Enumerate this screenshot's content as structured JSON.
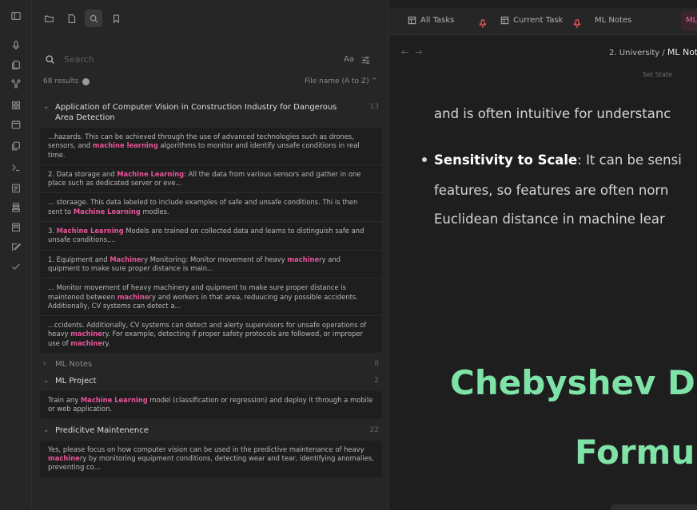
{
  "ribbon": {
    "icons": [
      "sidebar-toggle-icon",
      "microphone-icon",
      "file-copy-icon",
      "graph-icon",
      "grid-icon",
      "calendar-icon",
      "copy-icon",
      "terminal-icon",
      "template-icon",
      "layers-icon",
      "book-icon",
      "edit-icon",
      "check-icon"
    ]
  },
  "panel": {
    "tabs": [
      "folder-icon",
      "file-icon",
      "search-icon",
      "bookmark-icon"
    ],
    "search": {
      "placeholder": "Search",
      "value": "",
      "match_case_label": "Aa"
    },
    "results_count": "68 results",
    "sort_label": "File name (A to Z) ⌃",
    "files": [
      {
        "title": "Application of Computer Vision in Construction Industry for Dangerous Area Detection",
        "count": "13",
        "expanded": true,
        "matches": [
          [
            {
              "t": "...hazards. This can be achieved through the use of advanced technologies such as drones, sensors, and "
            },
            {
              "t": "machine learning",
              "h": true
            },
            {
              "t": " algorithms to monitor and identify unsafe conditions in real time."
            }
          ],
          [
            {
              "t": "2. Data storage and "
            },
            {
              "t": "Machine Learning",
              "h": true
            },
            {
              "t": ": All the data from various sensors and gather in one place such as dedicated server or eve..."
            }
          ],
          [
            {
              "t": "... storaage. This data labeled to include examples of safe and unsafe conditions. Thi is then sent to "
            },
            {
              "t": "Machine Learning",
              "h": true
            },
            {
              "t": " modles."
            }
          ],
          [
            {
              "t": "3. "
            },
            {
              "t": "Machine Learning",
              "h": true
            },
            {
              "t": " Models are trained on collected data and learns to distinguish safe and unsafe conditions,..."
            }
          ],
          [
            {
              "t": "1. Equipment and "
            },
            {
              "t": "Machine",
              "h": true
            },
            {
              "t": "ry Monitoring: Monitor movement of heavy "
            },
            {
              "t": "machine",
              "h": true
            },
            {
              "t": "ry and quipment to make sure proper distance is main..."
            }
          ],
          [
            {
              "t": "... Monitor movement of heavy machinery and quipment to make sure proper distance is maintened between "
            },
            {
              "t": "machine",
              "h": true
            },
            {
              "t": "ry and workers in that area, reduucing any possible accidents. Additionally, CV systems can detect a..."
            }
          ],
          [
            {
              "t": "...ccidents. Additionally, CV systems can detect and alerty supervisors for unsafe operations of heavy "
            },
            {
              "t": "machine",
              "h": true
            },
            {
              "t": "ry. For example, detecting if proper safety protocols are followed, or improper use of "
            },
            {
              "t": "machine",
              "h": true
            },
            {
              "t": "ry."
            }
          ]
        ]
      },
      {
        "title": "ML Notes",
        "count": "8",
        "expanded": false,
        "matches": []
      },
      {
        "title": "ML Project",
        "count": "2",
        "expanded": true,
        "matches": [
          [
            {
              "t": "Train any "
            },
            {
              "t": "Machine Learning",
              "h": true
            },
            {
              "t": " model (classification or regression) and deploy it through a mobile or web application."
            }
          ]
        ]
      },
      {
        "title": "Predicitve Maintenence",
        "count": "22",
        "expanded": true,
        "matches": [
          [
            {
              "t": "Yes, please focus on how computer vision can be used in the predictive maintenance of heavy "
            },
            {
              "t": "machine",
              "h": true
            },
            {
              "t": "ry by monitoring equipment conditions, detecting wear and tear, identifying anomalies, preventing co..."
            }
          ]
        ]
      }
    ]
  },
  "tabs": [
    {
      "label": "All Tasks",
      "icon": "table-icon"
    },
    {
      "label": "Current Task",
      "icon": "table-icon"
    },
    {
      "label": "ML Notes",
      "icon": ""
    }
  ],
  "active_tab_label": "ML",
  "nav": {
    "back": "←",
    "forward": "→"
  },
  "breadcrumb": {
    "parent": "2. University",
    "sep": " / ",
    "current": "ML Not"
  },
  "set_state": "Set State",
  "note": {
    "line1": "and is often intuitive for understanc",
    "bullet_bold": "Sensitivity to Scale",
    "bullet_rest": ": It can be sensi",
    "line3": "features, so features are often norn",
    "line4": "Euclidean distance in machine lear",
    "heading1": "Chebyshev D",
    "heading2": "Formu"
  },
  "colors": {
    "highlight": "#e6549a",
    "heading": "#7fe3a8",
    "pin": "#d94f4f"
  }
}
